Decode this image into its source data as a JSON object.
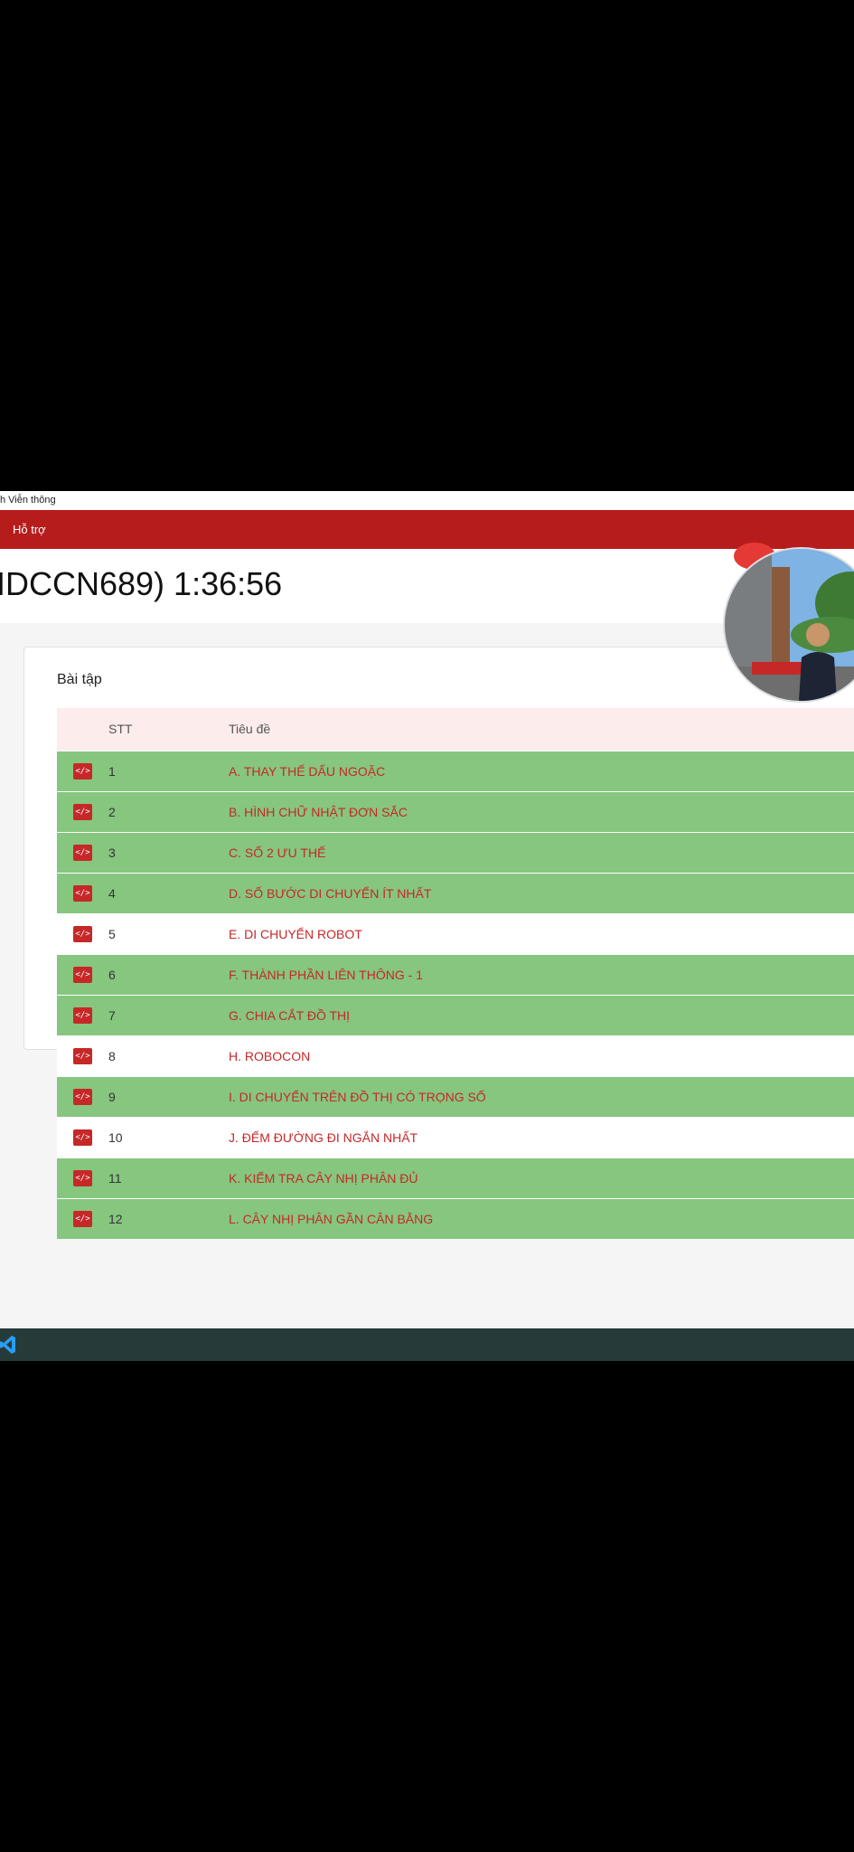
{
  "window": {
    "title": "h Viễn thông"
  },
  "navbar": {
    "support_label": "Hỗ trợ"
  },
  "header": {
    "title": "IDCCN689) 1:36:56"
  },
  "card": {
    "title": "Bài tập",
    "columns": {
      "stt": "STT",
      "title": "Tiêu đề"
    },
    "rows": [
      {
        "stt": "1",
        "title": "A. THAY THẾ DẤU NGOẶC",
        "solved": true
      },
      {
        "stt": "2",
        "title": "B. HÌNH CHỮ NHẬT ĐƠN SẮC",
        "solved": true
      },
      {
        "stt": "3",
        "title": "C. SỐ 2 ƯU THẾ",
        "solved": true
      },
      {
        "stt": "4",
        "title": "D. SỐ BƯỚC DI CHUYỂN ÍT NHẤT",
        "solved": true
      },
      {
        "stt": "5",
        "title": "E. DI CHUYỂN ROBOT",
        "solved": false
      },
      {
        "stt": "6",
        "title": "F. THÀNH PHẦN LIÊN THÔNG - 1",
        "solved": true
      },
      {
        "stt": "7",
        "title": "G. CHIA CẮT ĐỒ THỊ",
        "solved": true
      },
      {
        "stt": "8",
        "title": "H. ROBOCON",
        "solved": false
      },
      {
        "stt": "9",
        "title": "I. DI CHUYỂN TRÊN ĐỒ THỊ CÓ TRỌNG SỐ",
        "solved": true
      },
      {
        "stt": "10",
        "title": "J. ĐẾM ĐƯỜNG ĐI NGẮN NHẤT",
        "solved": false
      },
      {
        "stt": "11",
        "title": "K. KIỂM TRA CÂY NHỊ PHÂN ĐỦ",
        "solved": true
      },
      {
        "stt": "12",
        "title": "L. CÂY NHỊ PHÂN GẦN CÂN BẰNG",
        "solved": true
      }
    ]
  },
  "icons": {
    "row_icon": "code-icon",
    "taskbar_app": "vscode-icon",
    "overlay": "webcam-avatar"
  },
  "colors": {
    "brand_red": "#b71c1c",
    "solved_green": "#86c67f",
    "title_red": "#c62828"
  }
}
